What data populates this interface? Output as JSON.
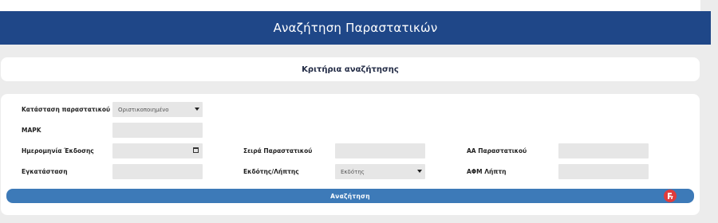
{
  "header": {
    "title": "Αναζήτηση Παραστατικών"
  },
  "criteria": {
    "title": "Κριτήρια αναζήτησης"
  },
  "form": {
    "status_label": "Κατάσταση παραστατικού",
    "status_value": "Οριστικοποιημένο",
    "mark_label": "ΜΑΡΚ",
    "issue_date_label": "Ημερομηνία Έκδοσης",
    "series_label": "Σειρά Παραστατικού",
    "aa_label": "ΑΑ Παραστατικού",
    "installation_label": "Εγκατάσταση",
    "issuer_receiver_label": "Εκδότης/Λήπτης",
    "issuer_receiver_value": "Εκδότης",
    "afm_label": "ΑΦΜ Λήπτη"
  },
  "actions": {
    "search_label": "Αναζήτηση"
  },
  "colors": {
    "banner": "#1f4788",
    "button": "#3d7ab8",
    "badge": "#e03c3c"
  },
  "icons": {
    "date": "calendar-icon",
    "badge": "helper-badge-icon"
  }
}
